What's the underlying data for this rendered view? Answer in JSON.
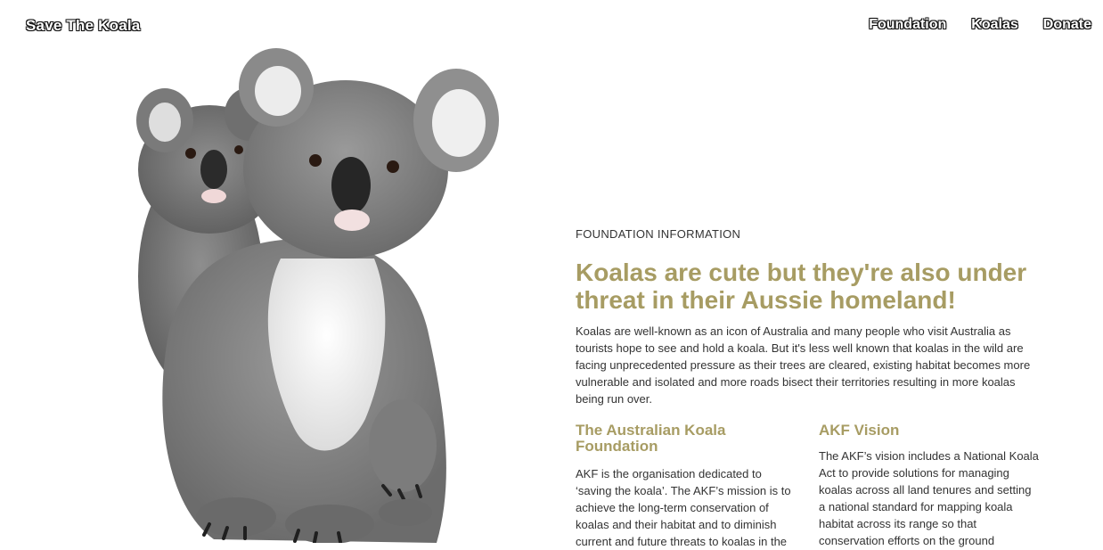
{
  "nav": {
    "brand": "Save The Koala",
    "links": [
      "Foundation",
      "Koalas",
      "Donate"
    ]
  },
  "hero": {
    "image": "koala-mother-and-joey-photo"
  },
  "main": {
    "eyebrow": "FOUNDATION INFORMATION",
    "headline_line1": "Koalas are cute but they're also under",
    "headline_line2": "threat in their Aussie homeland!",
    "intro": "Koalas are well-known as an icon of Australia and many people who visit Australia as tourists hope to see and hold a koala. But it's less well known that koalas in the wild are facing unprecedented pressure as their trees are cleared, existing habitat becomes more vulnerable and isolated and more roads bisect their territories resulting in more koalas being run over.",
    "col1": {
      "title": "The Australian Koala Foundation",
      "body": "AKF is the organisation dedicated to ‘saving the koala’. The AKF’s mission is to achieve the long-term conservation of koalas and their habitat and to diminish current and future threats to koalas in the"
    },
    "col2": {
      "title": "AKF Vision",
      "body": "The AKF’s vision includes a National Koala Act to provide solutions for managing koalas across all land tenures and setting a national standard for mapping koala habitat across its range so that conservation efforts on the ground"
    }
  },
  "colors": {
    "accent": "#a79c63",
    "text": "#333333",
    "background": "#ffffff"
  }
}
